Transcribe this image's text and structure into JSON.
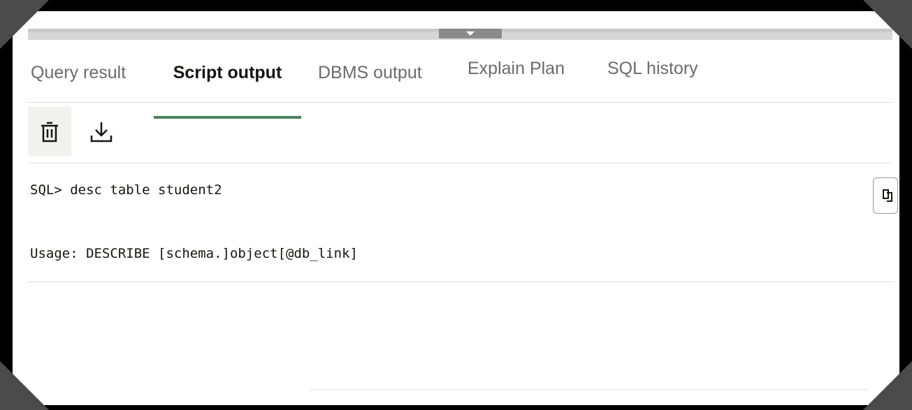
{
  "tabs": [
    {
      "label": "Query result",
      "active": false
    },
    {
      "label": "Script output",
      "active": true
    },
    {
      "label": "DBMS output",
      "active": false
    },
    {
      "label": "Explain Plan",
      "active": false
    },
    {
      "label": "SQL history",
      "active": false
    }
  ],
  "toolbar": {
    "clear_icon": "trash-icon",
    "download_icon": "download-icon"
  },
  "output": {
    "lines": [
      "SQL> desc table student2",
      "Usage: DESCRIBE [schema.]object[@db_link]"
    ],
    "copy_icon": "copy-icon"
  },
  "colors": {
    "active_tab_underline": "#4c825c",
    "active_tab_text": "#161513",
    "inactive_tab_text": "#6b6b6b"
  }
}
